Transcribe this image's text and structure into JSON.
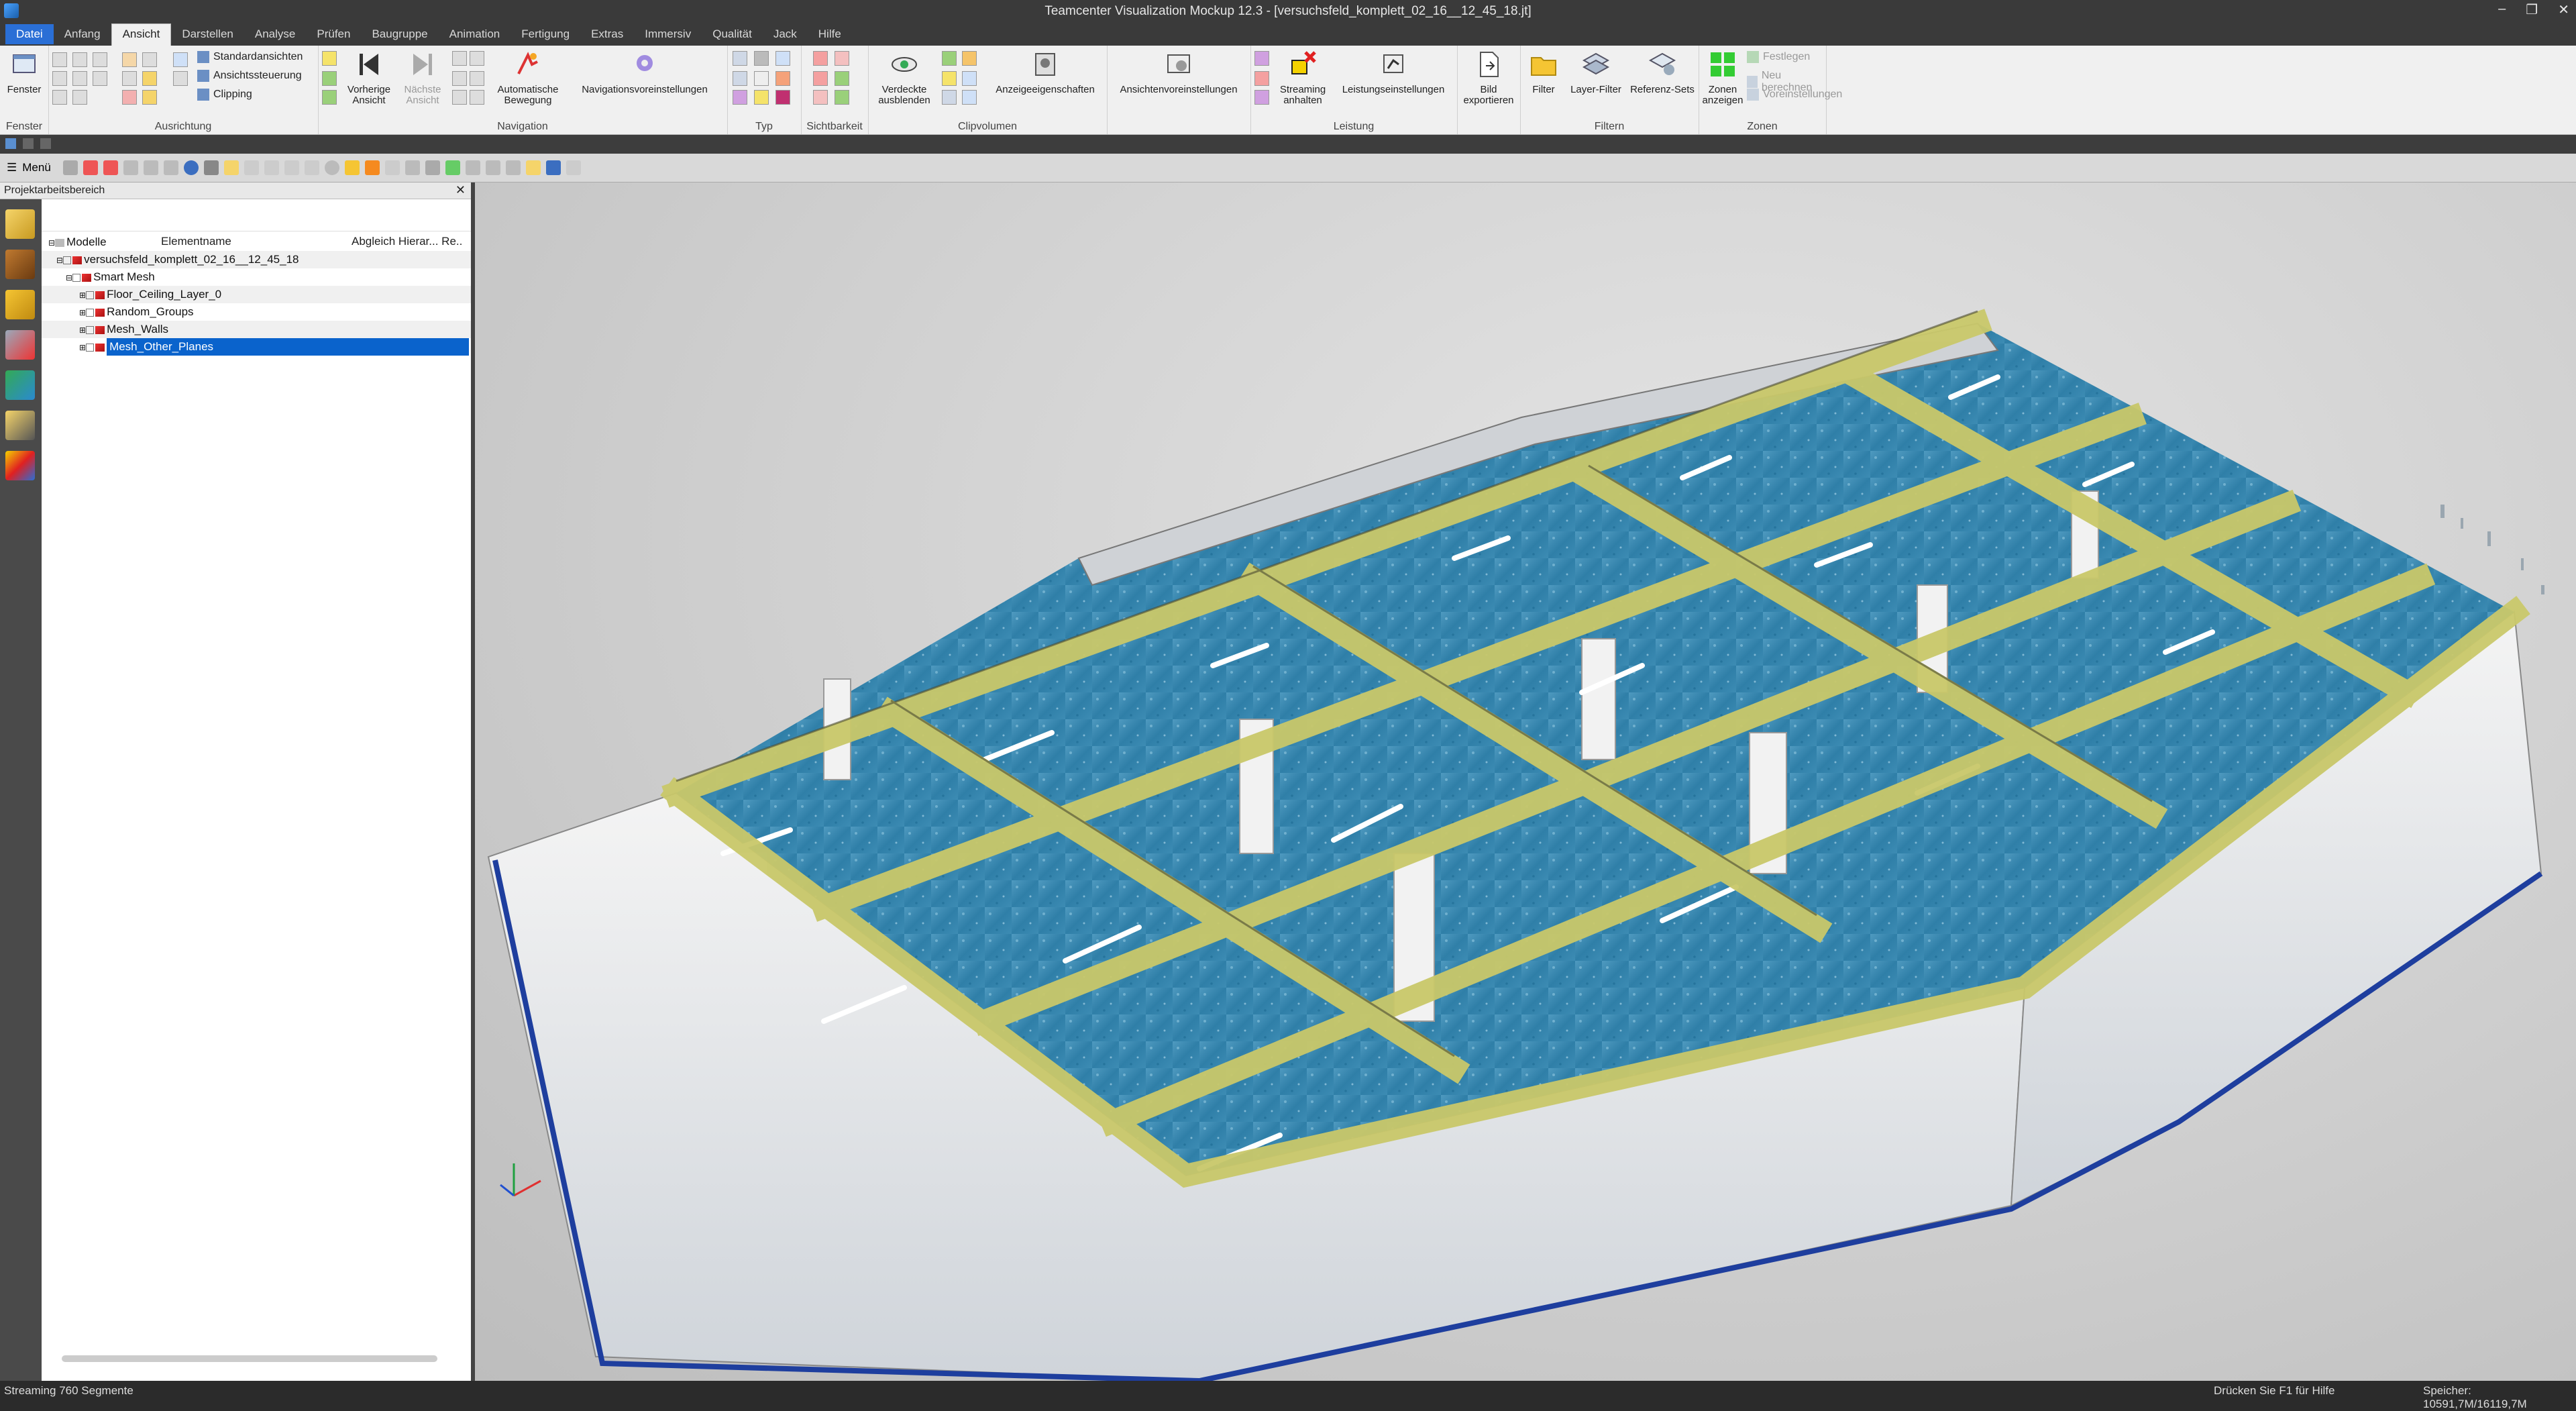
{
  "window": {
    "title": "Teamcenter Visualization Mockup 12.3 - [versuchsfeld_komplett_02_16__12_45_18.jt]"
  },
  "menu_tabs": [
    "Datei",
    "Anfang",
    "Ansicht",
    "Darstellen",
    "Analyse",
    "Prüfen",
    "Baugruppe",
    "Animation",
    "Fertigung",
    "Extras",
    "Immersiv",
    "Qualität",
    "Jack",
    "Hilfe"
  ],
  "ribbon": {
    "groups": {
      "fenster": "Fenster",
      "ausrichtung": "Ausrichtung",
      "navigation": "Navigation",
      "typ": "Typ",
      "sichtbarkeit": "Sichtbarkeit",
      "clipvolumen": "Clipvolumen",
      "leistung": "Leistung",
      "filtern": "Filtern",
      "zonen": "Zonen"
    },
    "fenster_btn": "Fenster",
    "standardansichten": "Standardansichten",
    "ansichtssteuerung": "Ansichtssteuerung",
    "clipping": "Clipping",
    "vorherige_l1": "Vorherige",
    "vorherige_l2": "Ansicht",
    "naechste_l1": "Nächste",
    "naechste_l2": "Ansicht",
    "automatische_l1": "Automatische",
    "automatische_l2": "Bewegung",
    "navigationsvoreinstellungen": "Navigationsvoreinstellungen",
    "verdeckte_l1": "Verdeckte",
    "verdeckte_l2": "ausblenden",
    "anzeigeeigenschaften": "Anzeigeeigenschaften",
    "ansichtenvoreinstellungen": "Ansichtenvoreinstellungen",
    "streaming_l1": "Streaming",
    "streaming_l2": "anhalten",
    "leistungseinstellungen": "Leistungseinstellungen",
    "bild_l1": "Bild",
    "bild_l2": "exportieren",
    "filter": "Filter",
    "layer_filter": "Layer-Filter",
    "referenz_sets": "Referenz-Sets",
    "zonen_l1": "Zonen",
    "zonen_l2": "anzeigen",
    "festlegen": "Festlegen",
    "neu_berechnen": "Neu berechnen",
    "voreinstellungen": "Voreinstellungen"
  },
  "toolbar2": {
    "menu_label": "Menü"
  },
  "panel": {
    "title": "Projektarbeitsbereich",
    "col_name": "Elementname",
    "col_right": "Abgleich Hierar... Re..",
    "tree": [
      {
        "label": "Modelle",
        "indent": 0
      },
      {
        "label": "versuchsfeld_komplett_02_16__12_45_18",
        "indent": 1
      },
      {
        "label": "Smart Mesh",
        "indent": 2
      },
      {
        "label": "Floor_Ceiling_Layer_0",
        "indent": 3
      },
      {
        "label": "Random_Groups",
        "indent": 3
      },
      {
        "label": "Mesh_Walls",
        "indent": 3
      },
      {
        "label": "Mesh_Other_Planes",
        "indent": 3
      }
    ]
  },
  "status": {
    "left": "Streaming 760 Segmente",
    "help": "Drücken Sie F1 für Hilfe",
    "memory": "Speicher: 10591,7M/16119,7M"
  },
  "colors": {
    "accent": "#2a6fd6",
    "selection": "#0a63cc",
    "beam": "#c9c86a",
    "floor": "#2f7fa8"
  }
}
